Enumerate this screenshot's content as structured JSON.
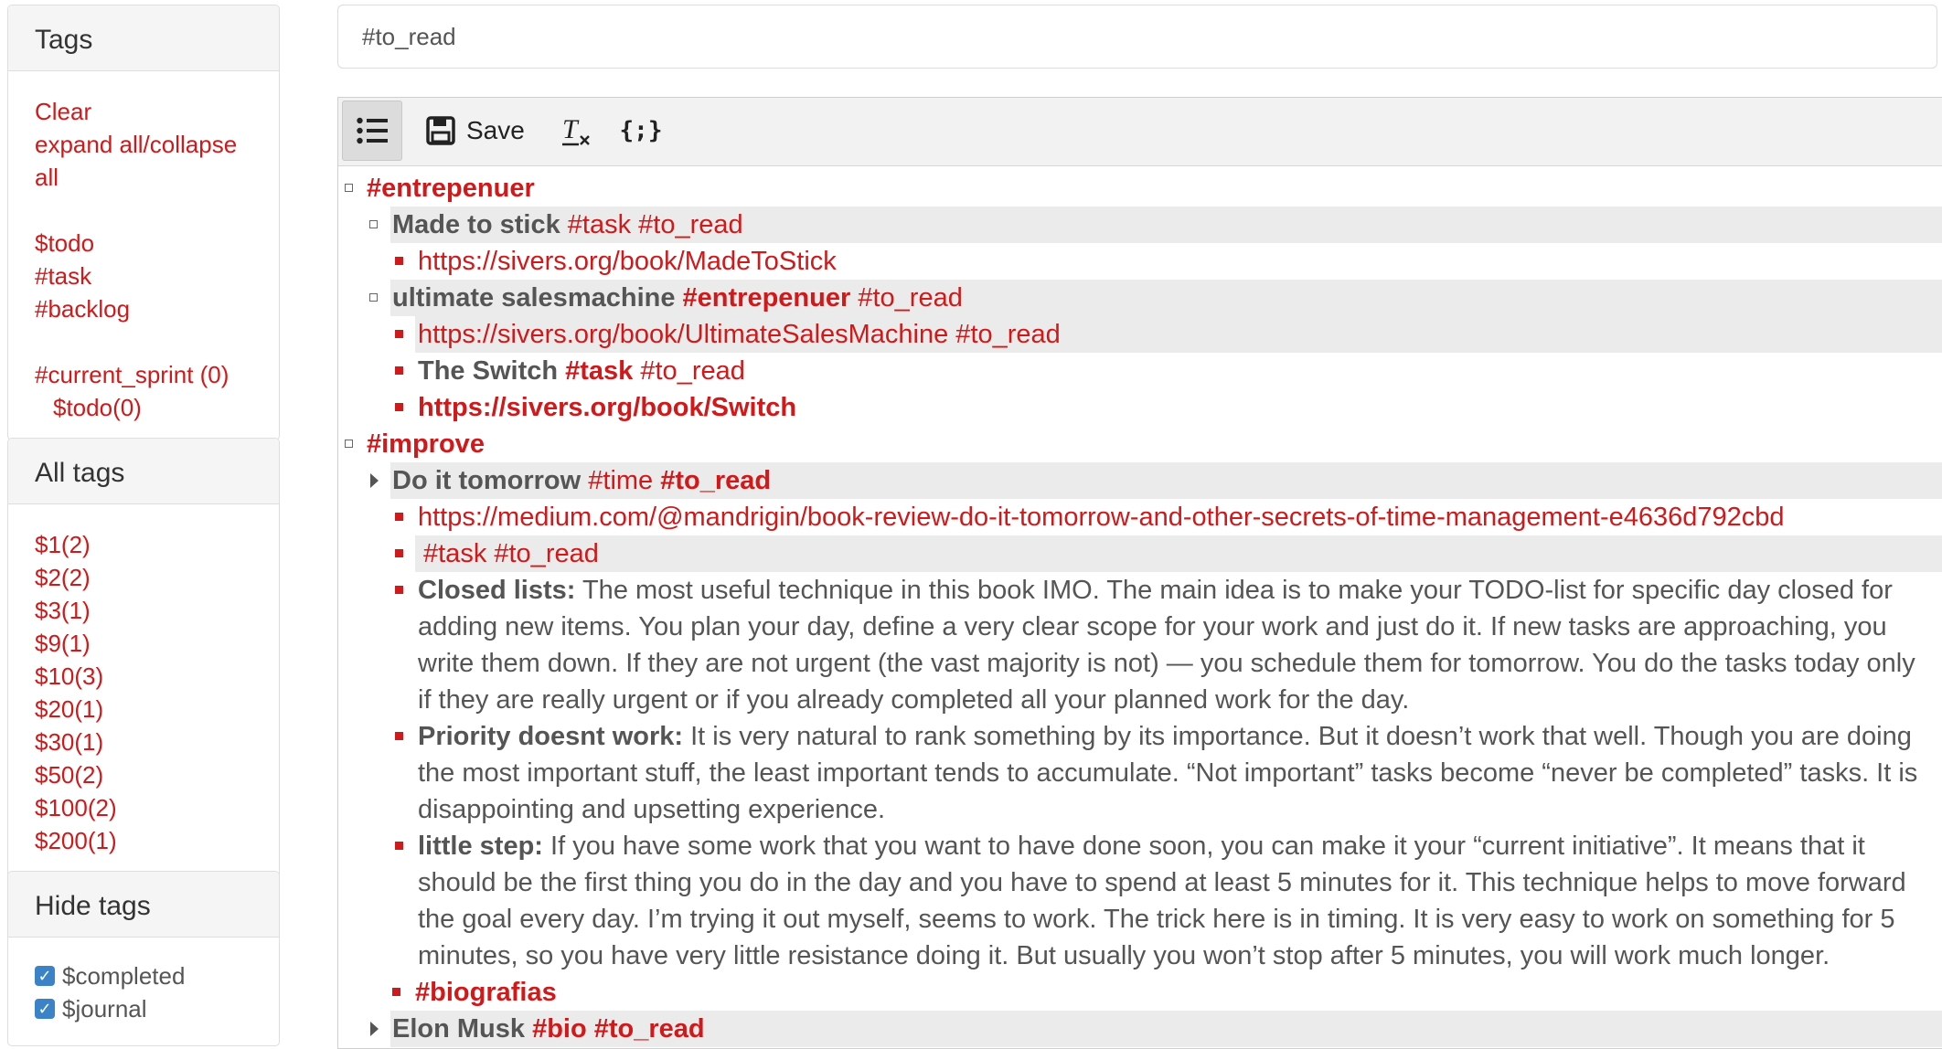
{
  "sidebar": {
    "tags_panel": {
      "title": "Tags",
      "clear": "Clear",
      "expand_line1": "expand all/collapse",
      "expand_line2": "all",
      "items": [
        "$todo",
        "#task",
        "#backlog"
      ],
      "sprint": "#current_sprint (0)",
      "sprint_child": "$todo(0)"
    },
    "all_tags_panel": {
      "title": "All tags",
      "items": [
        "$1(2)",
        "$2(2)",
        "$3(1)",
        "$9(1)",
        "$10(3)",
        "$20(1)",
        "$30(1)",
        "$50(2)",
        "$100(2)",
        "$200(1)"
      ]
    },
    "hide_tags_panel": {
      "title": "Hide tags",
      "items": [
        "$completed",
        "$journal"
      ]
    }
  },
  "search": {
    "value": "#to_read"
  },
  "toolbar": {
    "list_icon": "bullet-list-icon",
    "save_label": "Save",
    "clear_format_icon": "clear-formatting-icon",
    "code_label": "{;}"
  },
  "tree": {
    "r1": "#entrepenuer",
    "r2_title": "Made to stick",
    "r2_tags": "#task #to_read",
    "r3": "https://sivers.org/book/MadeToStick",
    "r4_title": "ultimate salesmachine",
    "r4_tag1": "#entrepenuer",
    "r4_tag2": "#to_read",
    "r5": "https://sivers.org/book/UltimateSalesMachine #to_read",
    "r6_title": "The Switch",
    "r6_tag1": "#task",
    "r6_tag2": "#to_read",
    "r7": "https://sivers.org/book/Switch",
    "r8": "#improve",
    "r9_title": "Do it tomorrow",
    "r9_tag1": "#time",
    "r9_tag2": "#to_read",
    "r10": "https://medium.com/@mandrigin/book-review-do-it-tomorrow-and-other-secrets-of-time-management-e4636d792cbd",
    "r11": "#task #to_read",
    "p1_bold": "Closed lists:",
    "p1_text": " The most useful technique in this book IMO. The main idea is to make your TODO-list for specific day closed for adding new items. You plan your day, define a very clear scope for your work and just do it. If new tasks are approaching, you write them down. If they are not urgent (the vast majority is not) — you schedule them for tomorrow. You do the tasks today only if they are really urgent or if you already completed all your planned work for the day.",
    "p2_bold": "Priority doesnt work:",
    "p2_text": " It is very natural to rank something by its importance. But it doesn’t work that well. Though you are doing the most important stuff, the least important tends to accumulate. “Not important” tasks become “never be completed” tasks. It is disappointing and upsetting experience.",
    "p3_bold": "little step:",
    "p3_text": " If you have some work that you want to have done soon, you can make it your “current initiative”. It means that it should be the first thing you do in the day and you have to spend at least 5 minutes for it. This technique helps to move forward the goal every day. I’m trying it out myself, seems to work. The trick here is in timing. It is very easy to work on something for 5 minutes, so you have very little resistance doing it. But usually you won’t stop after 5 minutes, you will work much longer.",
    "r12": "#biografias",
    "r13_title": "Elon Musk",
    "r13_tag1": "#bio",
    "r13_tag2": "#to_read"
  },
  "colors": {
    "tag_red": "#d0191a",
    "text_gray": "#555555",
    "highlight": "#ebebeb",
    "checkbox_blue": "#3b82c7"
  }
}
